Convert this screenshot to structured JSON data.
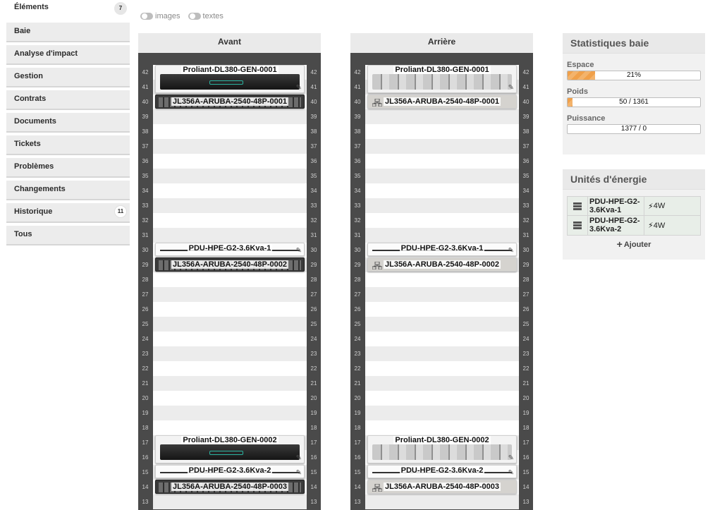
{
  "sidebar": {
    "tabs": [
      {
        "label": "Éléments",
        "badge": "7",
        "active": true
      },
      {
        "label": "Baie"
      },
      {
        "label": "Analyse d'impact"
      },
      {
        "label": "Gestion"
      },
      {
        "label": "Contrats"
      },
      {
        "label": "Documents"
      },
      {
        "label": "Tickets"
      },
      {
        "label": "Problèmes"
      },
      {
        "label": "Changements"
      },
      {
        "label": "Historique",
        "badge": "11"
      },
      {
        "label": "Tous"
      }
    ]
  },
  "toggles": {
    "images": "images",
    "texts": "textes"
  },
  "racks": {
    "front": {
      "title": "Avant",
      "items": [
        {
          "label": "Proliant-DL380-GEN-0001",
          "kind": "server"
        },
        {
          "label": "JL356A-ARUBA-2540-48P-0001",
          "kind": "switch"
        },
        {
          "label": "PDU-HPE-G2-3.6Kva-1",
          "kind": "pdu"
        },
        {
          "label": "JL356A-ARUBA-2540-48P-0002",
          "kind": "switch"
        },
        {
          "label": "Proliant-DL380-GEN-0002",
          "kind": "server"
        },
        {
          "label": "PDU-HPE-G2-3.6Kva-2",
          "kind": "pdu"
        },
        {
          "label": "JL356A-ARUBA-2540-48P-0003",
          "kind": "switch"
        }
      ]
    },
    "back": {
      "title": "Arrière",
      "items": [
        {
          "label": "Proliant-DL380-GEN-0001",
          "kind": "server"
        },
        {
          "label": "JL356A-ARUBA-2540-48P-0001",
          "kind": "switch"
        },
        {
          "label": "PDU-HPE-G2-3.6Kva-1",
          "kind": "pdu"
        },
        {
          "label": "JL356A-ARUBA-2540-48P-0002",
          "kind": "switch"
        },
        {
          "label": "Proliant-DL380-GEN-0002",
          "kind": "server"
        },
        {
          "label": "PDU-HPE-G2-3.6Kva-2",
          "kind": "pdu"
        },
        {
          "label": "JL356A-ARUBA-2540-48P-0003",
          "kind": "switch"
        }
      ]
    },
    "unit_numbers": [
      "42",
      "41",
      "40",
      "39",
      "38",
      "37",
      "36",
      "35",
      "34",
      "33",
      "32",
      "31",
      "30",
      "29",
      "28",
      "27",
      "26",
      "25",
      "24",
      "23",
      "22",
      "21",
      "20",
      "19",
      "18",
      "17",
      "16",
      "15",
      "14",
      "13"
    ]
  },
  "stats": {
    "title": "Statistiques baie",
    "space": {
      "label": "Espace",
      "text": "21%",
      "fraction": 0.21
    },
    "weight": {
      "label": "Poids",
      "text": "50 / 1361",
      "fraction": 0.0367
    },
    "power": {
      "label": "Puissance",
      "text": "1377 / 0",
      "fraction": 0
    }
  },
  "energy": {
    "title": "Unités d'énergie",
    "pdus": [
      {
        "name": "PDU-HPE-G2-3.6Kva-1",
        "power": "4W"
      },
      {
        "name": "PDU-HPE-G2-3.6Kva-2",
        "power": "4W"
      }
    ],
    "add_label": "Ajouter"
  },
  "colors": {
    "progress": "#f0a04a",
    "rack": "#4a4a4a",
    "accent_teal": "#2bb3a0"
  }
}
